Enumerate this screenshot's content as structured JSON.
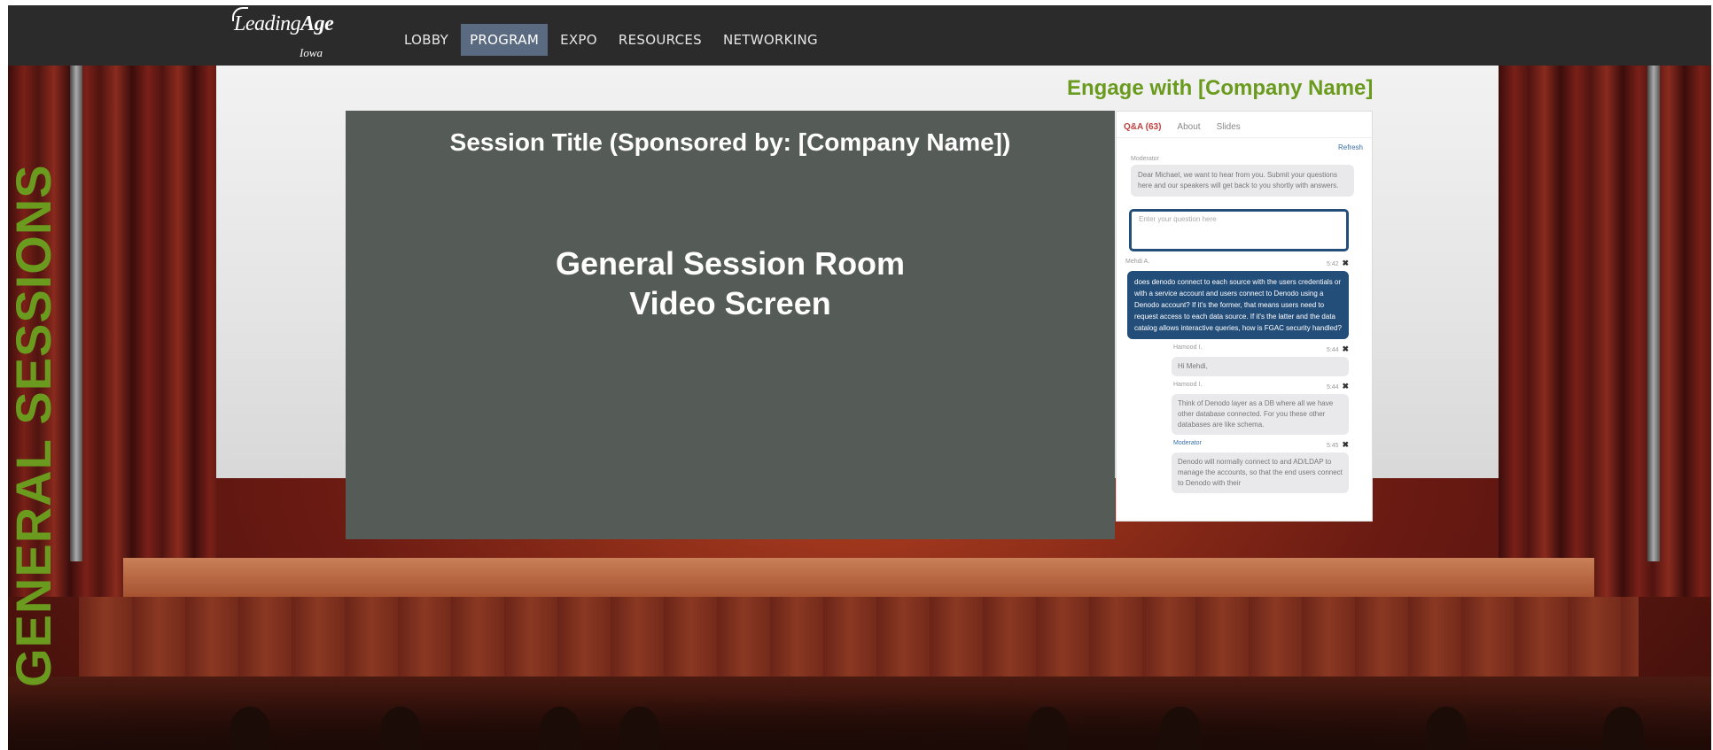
{
  "logo": {
    "brand": "LeadingAge",
    "brand_prefix": "Leading",
    "brand_suffix": "Age",
    "region": "Iowa"
  },
  "nav": {
    "items": [
      {
        "label": "LOBBY",
        "active": false
      },
      {
        "label": "PROGRAM",
        "active": true
      },
      {
        "label": "EXPO",
        "active": false
      },
      {
        "label": "RESOURCES",
        "active": false
      },
      {
        "label": "NETWORKING",
        "active": false
      }
    ]
  },
  "side_label": "GENERAL SESSIONS",
  "engage_heading": "Engage with [Company Name]",
  "video": {
    "session_title": "Session Title (Sponsored by: [Company Name])",
    "screen_line1": "General Session Room",
    "screen_line2": "Video Screen"
  },
  "qa": {
    "tabs": [
      "Q&A (63)",
      "About",
      "Slides"
    ],
    "refresh": "Refresh",
    "welcome_author": "Moderator",
    "welcome_text": "Dear Michael, we want to hear from you. Submit your questions here and our speakers will get back to you shortly with answers.",
    "input_placeholder": "Enter your question here",
    "question_author": "Mehdi A.",
    "question_time": "5:42",
    "question_text": "does denodo connect to each source with the users credentials or with a service account and users connect to Denodo using a Denodo account? If it's the former, that means users need to request access to each data source. If it's the latter and the data catalog allows interactive queries, how is FGAC security handled?",
    "replies": [
      {
        "author": "Hamood I.",
        "time": "5:44",
        "text": "Hi Mehdi,"
      },
      {
        "author": "Hamood I.",
        "time": "5:44",
        "text": "Think of Denodo layer as a DB where all we have other database connected. For you these other databases are like schema."
      },
      {
        "author": "Moderator",
        "time": "5:45",
        "text": "Denodo will normally connect to and AD/LDAP to manage the accounts, so that the end users connect to Denodo with their"
      }
    ],
    "close_glyph": "✖"
  },
  "colors": {
    "accent_green": "#6a9a1e",
    "nav_bg": "#2b2b2b",
    "nav_active": "#5a6a80",
    "screen_bg": "#555b56",
    "qa_blue": "#244e7a"
  }
}
